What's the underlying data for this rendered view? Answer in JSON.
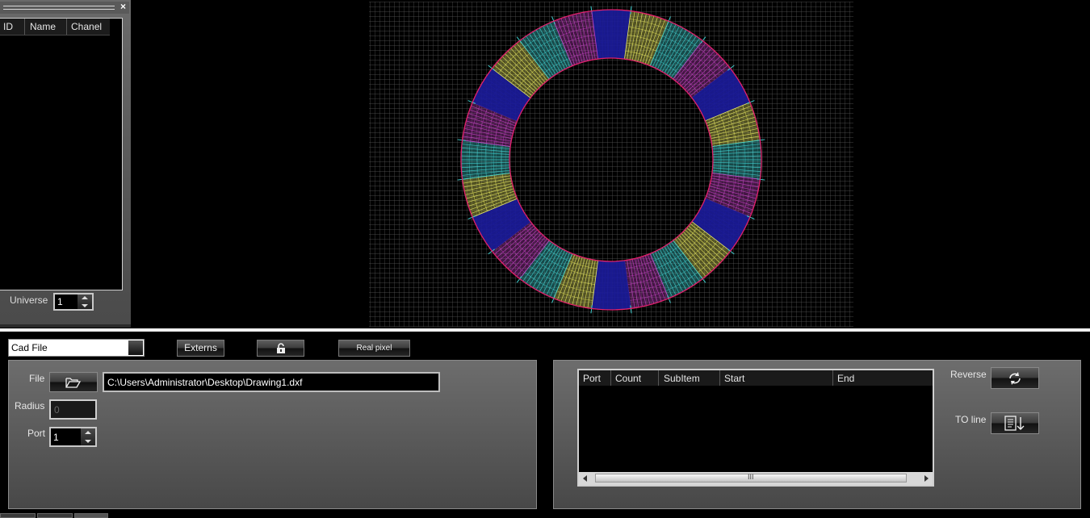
{
  "left_panel": {
    "close_glyph": "×",
    "table_headers": [
      "ID",
      "Name",
      "Chanel"
    ],
    "universe_label": "Universe",
    "universe_value": "1"
  },
  "toolbar": {
    "cad_select": "Cad File",
    "externs_label": "Externs",
    "lock_icon": "unlock-icon",
    "real_pixel_label": "Real pixel"
  },
  "file_panel": {
    "file_label": "File",
    "file_path": "C:\\Users\\Administrator\\Desktop\\Drawing1.dxf",
    "radius_label": "Radius",
    "radius_value": "0",
    "port_label": "Port",
    "port_value": "1"
  },
  "port_panel": {
    "table_headers": [
      "Port",
      "Count",
      "SubItem",
      "Start",
      "End"
    ],
    "reverse_label": "Reverse",
    "to_line_label": "TO line",
    "scroll_grip": "III"
  },
  "ring": {
    "segment_count": 24,
    "colors": [
      "#1c1c9a",
      "#e8e860",
      "#40d0d0",
      "#c040c0"
    ],
    "outline_color": "#e0206a",
    "grid_color": "#5a5a5a"
  }
}
